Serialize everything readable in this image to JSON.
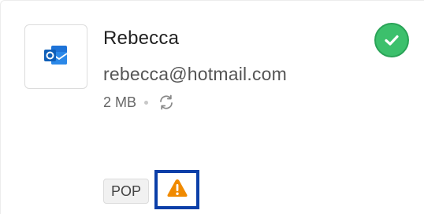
{
  "account": {
    "app_icon": "outlook-icon",
    "name": "Rebecca",
    "email": "rebecca@hotmail.com",
    "size": "2 MB",
    "sync_icon": "refresh-icon",
    "status_icon": "check-circle-icon",
    "protocol": "POP",
    "warning_icon": "warning-triangle-icon"
  },
  "colors": {
    "outlook_blue": "#1e73d8",
    "success_green": "#3cc06c",
    "warning_orange": "#f08a00",
    "highlight_blue": "#0b3fa8"
  }
}
